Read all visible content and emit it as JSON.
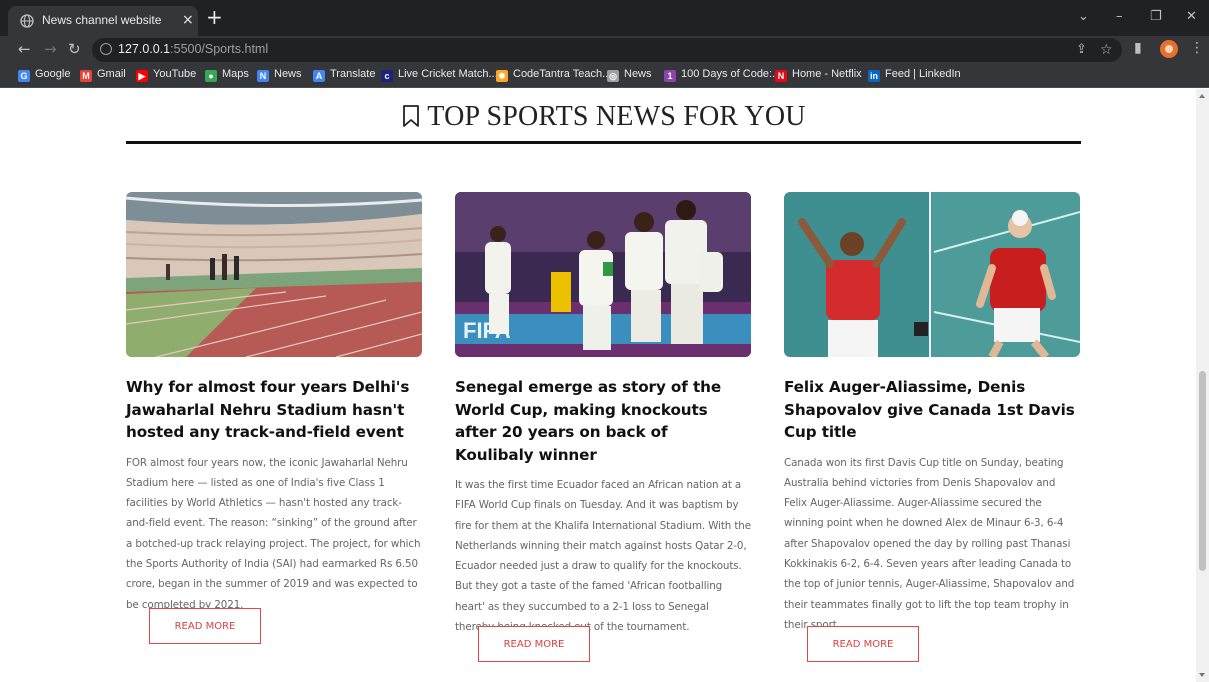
{
  "browser": {
    "tab_title": "News channel website",
    "tab_close": "×",
    "new_tab": "+",
    "url_host": "127.0.0.1",
    "url_rest": ":5500/Sports.html",
    "bookmarks": [
      {
        "label": "Google",
        "icon": "google-icon",
        "color": "#4285f4"
      },
      {
        "label": "Gmail",
        "icon": "gmail-icon",
        "color": "#ea4335"
      },
      {
        "label": "YouTube",
        "icon": "youtube-icon",
        "color": "#ff0000"
      },
      {
        "label": "Maps",
        "icon": "maps-icon",
        "color": "#34a853"
      },
      {
        "label": "News",
        "icon": "news-icon",
        "color": "#4285f4"
      },
      {
        "label": "Translate",
        "icon": "translate-icon",
        "color": "#4285f4"
      },
      {
        "label": "Live Cricket Match...",
        "icon": "cricket-icon",
        "color": "#1a237e"
      },
      {
        "label": "CodeTantra Teach...",
        "icon": "codetantra-icon",
        "color": "#f9a825"
      },
      {
        "label": "News",
        "icon": "globe-icon",
        "color": "#9aa0a6"
      },
      {
        "label": "100 Days of Code:...",
        "icon": "course-icon",
        "color": "#8e44ad"
      },
      {
        "label": "Home - Netflix",
        "icon": "netflix-icon",
        "color": "#e50914"
      },
      {
        "label": "Feed | LinkedIn",
        "icon": "linkedin-icon",
        "color": "#0a66c2"
      }
    ]
  },
  "page": {
    "heading": "TOP SPORTS NEWS FOR YOU",
    "articles": [
      {
        "title": "Why for almost four years Delhi's Jawaharlal Nehru Stadium hasn't hosted any track-and-field event",
        "body": "FOR almost four years now, the iconic Jawaharlal Nehru Stadium here — listed as one of India's five Class 1 facilities by World Athletics — hasn't hosted any track-and-field event. The reason: “sinking” of the ground after a botched-up track relaying project. The project, for which the Sports Authority of India (SAI) had earmarked Rs 6.50 crore, began in the summer of 2019 and was expected to be completed by 2021.",
        "button": "READ MORE"
      },
      {
        "title": "Senegal emerge as story of the World Cup, making knockouts after 20 years on back of Koulibaly winner",
        "body": "It was the first time Ecuador faced an African nation at a FIFA World Cup finals on Tuesday. And it was baptism by fire for them at the Khalifa International Stadium. With the Netherlands winning their match against hosts Qatar 2-0, Ecuador needed just a draw to qualify for the knockouts. But they got a taste of the famed 'African footballing heart' as they succumbed to a 2-1 loss to Senegal thereby being knocked out of the tournament.",
        "button": "READ MORE"
      },
      {
        "title": "Felix Auger-Aliassime, Denis Shapovalov give Canada 1st Davis Cup title",
        "body": "Canada won its first Davis Cup title on Sunday, beating Australia behind victories from Denis Shapovalov and Felix Auger-Aliassime. Auger-Aliassime secured the winning point when he downed Alex de Minaur 6-3, 6-4 after Shapovalov opened the day by rolling past Thanasi Kokkinakis 6-2, 6-4. Seven years after leading Canada to the top of junior tennis, Auger-Aliassime, Shapovalov and their teammates finally got to lift the top team trophy in their sport.",
        "button": "READ MORE"
      }
    ]
  },
  "colors": {
    "accent": "#e04848",
    "heading_rule": "#111111"
  }
}
